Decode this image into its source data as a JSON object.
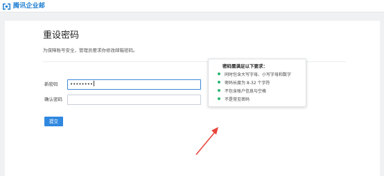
{
  "app": {
    "name": "腾讯企业邮",
    "logo_color": "#1f7fd1"
  },
  "page": {
    "title": "重设密码",
    "subtitle": "为保障账号安全，管理员要求你修改邮箱密码。"
  },
  "form": {
    "new_password_label": "新密码",
    "new_password_value": "••••••••",
    "confirm_password_label": "确认密码",
    "confirm_password_value": "",
    "submit_label": "提交"
  },
  "requirements": {
    "title": "密码需满足以下要求：",
    "items": [
      "同时包含大写字母、小写字母和数字",
      "密码长度为 8-32 个字符",
      "不包含账户信息与空格",
      "不是常见密码"
    ],
    "bullet_color": "#2bb673"
  },
  "annotation": {
    "arrow_icon": "red-arrow-icon",
    "color": "#e8443a"
  }
}
